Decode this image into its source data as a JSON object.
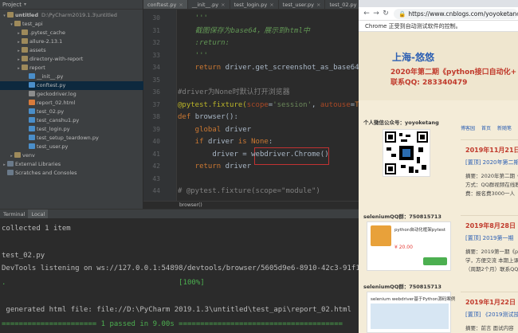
{
  "ide": {
    "project_label": "Project",
    "tree": [
      {
        "label": "untitled",
        "path": "D:\\PyCharm2019.1.3\\untitled",
        "icon": "folder",
        "indent": 0,
        "arrow": "▾",
        "bold": true
      },
      {
        "label": "test_api",
        "icon": "folder",
        "indent": 1,
        "arrow": "▾"
      },
      {
        "label": ".pytest_cache",
        "icon": "folder",
        "indent": 2,
        "arrow": "▸"
      },
      {
        "label": "allure-2.13.1",
        "icon": "folder",
        "indent": 2,
        "arrow": "▸"
      },
      {
        "label": "assets",
        "icon": "folder",
        "indent": 2,
        "arrow": "▸"
      },
      {
        "label": "directory-with-report",
        "icon": "folder",
        "indent": 2,
        "arrow": "▸"
      },
      {
        "label": "report",
        "icon": "folder",
        "indent": 2,
        "arrow": "▸"
      },
      {
        "label": "__init__.py",
        "icon": "py",
        "indent": 3,
        "arrow": ""
      },
      {
        "label": "conftest.py",
        "icon": "py",
        "indent": 3,
        "arrow": "",
        "selected": true
      },
      {
        "label": "geckodriver.log",
        "icon": "log",
        "indent": 3,
        "arrow": ""
      },
      {
        "label": "report_02.html",
        "icon": "html",
        "indent": 3,
        "arrow": ""
      },
      {
        "label": "test_02.py",
        "icon": "py",
        "indent": 3,
        "arrow": ""
      },
      {
        "label": "test_canshu1.py",
        "icon": "py",
        "indent": 3,
        "arrow": ""
      },
      {
        "label": "test_login.py",
        "icon": "py",
        "indent": 3,
        "arrow": ""
      },
      {
        "label": "test_setup_teardown.py",
        "icon": "py",
        "indent": 3,
        "arrow": ""
      },
      {
        "label": "test_user.py",
        "icon": "py",
        "indent": 3,
        "arrow": ""
      },
      {
        "label": "venv",
        "icon": "folder",
        "indent": 1,
        "arrow": "▸"
      },
      {
        "label": "External Libraries",
        "icon": "lib",
        "indent": 0,
        "arrow": "▸"
      },
      {
        "label": "Scratches and Consoles",
        "icon": "lib",
        "indent": 0,
        "arrow": ""
      }
    ],
    "tabs": [
      {
        "label": "conftest.py",
        "active": true
      },
      {
        "label": "__init__.py"
      },
      {
        "label": "test_login.py"
      },
      {
        "label": "test_user.py"
      },
      {
        "label": "test_02.py"
      }
    ],
    "line_numbers": [
      "30",
      "31",
      "32",
      "33",
      "34",
      "35",
      "36",
      "37",
      "38",
      "39",
      "40",
      "41",
      "42",
      "43",
      "44"
    ],
    "code": [
      {
        "parts": [
          [
            "cm",
            "    '''"
          ]
        ]
      },
      {
        "parts": [
          [
            "cm",
            "    截图保存为base64，展示到html中"
          ]
        ]
      },
      {
        "parts": [
          [
            "cm",
            "    :return:"
          ]
        ]
      },
      {
        "parts": [
          [
            "cm",
            "    '''"
          ]
        ]
      },
      {
        "parts": [
          [
            "kw",
            "    return "
          ],
          [
            "plain",
            "driver.get_screenshot_as_base64()"
          ]
        ]
      },
      {
        "parts": [
          [
            "plain",
            ""
          ]
        ]
      },
      {
        "parts": [
          [
            "grey",
            "#driver为None时默认打开浏览器"
          ]
        ]
      },
      {
        "parts": [
          [
            "dec",
            "@pytest.fixture("
          ],
          [
            "par",
            "scope"
          ],
          [
            "plain",
            "="
          ],
          [
            "str",
            "'session'"
          ],
          [
            "plain",
            ", "
          ],
          [
            "par",
            "autouse"
          ],
          [
            "plain",
            "="
          ],
          [
            "kw",
            "True"
          ]
        ]
      },
      {
        "parts": [
          [
            "kw",
            "def "
          ],
          [
            "fn",
            "browser():"
          ]
        ]
      },
      {
        "parts": [
          [
            "kw",
            "    global "
          ],
          [
            "plain",
            "driver"
          ]
        ]
      },
      {
        "parts": [
          [
            "kw",
            "    if "
          ],
          [
            "plain",
            "driver "
          ],
          [
            "kw",
            "is None"
          ],
          [
            "plain",
            ":"
          ]
        ]
      },
      {
        "parts": [
          [
            "plain",
            "        driver = webdriver.Chrome()"
          ]
        ]
      },
      {
        "parts": [
          [
            "kw",
            "    return "
          ],
          [
            "plain",
            "driver"
          ]
        ]
      },
      {
        "parts": [
          [
            "plain",
            ""
          ]
        ]
      },
      {
        "parts": [
          [
            "grey",
            "# @pytest.fixture(scope=\"module\")"
          ]
        ]
      }
    ],
    "breadcrumb": "browser()",
    "terminal_tabs": [
      "Terminal",
      "Local"
    ],
    "terminal_lines": [
      {
        "text": "collected 1 item",
        "cls": ""
      },
      {
        "text": "",
        "cls": ""
      },
      {
        "text": "test_02.py",
        "cls": ""
      },
      {
        "text": "DevTools listening on ws://127.0.0.1:54898/devtools/browser/5605d9e6-8910-42c3-91f1-12635a",
        "cls": ""
      },
      {
        "text": ".                                        [100%]",
        "cls": "green"
      },
      {
        "text": "",
        "cls": ""
      },
      {
        "text": " generated html file: file://D:\\PyCharm 2019.1.3\\untitled\\test_api\\report_02.html",
        "cls": ""
      },
      {
        "text": "====================== 1 passed in 9.00s ======================================",
        "cls": "green"
      }
    ]
  },
  "browser": {
    "url": "https://www.cnblogs.com/yoyoketang",
    "controlled_notice": "Chrome 正受到自动测试软件的控制。",
    "banner_title": "上海-悠悠",
    "banner_line1": "2020年第二期《python接口自动化+",
    "banner_line2": "联系QQ: 283340479",
    "sidebar_wechat": "个人微信公众号：yoyoketang",
    "sidebar_qq1": "seleniumQQ群：750815713",
    "sidebar_qq2": "seleniumQQ群：750815713",
    "card1_title": "python自动化框架pytest",
    "card1_price": "¥ 20.00",
    "card2_title": "selenium webdriver基于Python源码案例",
    "menu": [
      "博客园",
      "首页",
      "新随笔"
    ],
    "posts": [
      {
        "date": "2019年11月21日",
        "title": "[置顶] 2020年第二期",
        "lines": [
          "摘要：2020年第二期《",
          "方式：QQ群视频在线教",
          "费：报名费3000一人（"
        ]
      },
      {
        "date": "2019年8月28日",
        "title": "[置顶] 2019第一期",
        "lines": [
          "摘要：2019第一期《p",
          "学，方便交流 本期上课",
          "（周期2个月）联系QQ"
        ]
      },
      {
        "date": "2019年1月22日",
        "title": "[置顶] 《2019测试技",
        "lines": [
          "摘要：前言 面试内容"
        ]
      }
    ]
  }
}
